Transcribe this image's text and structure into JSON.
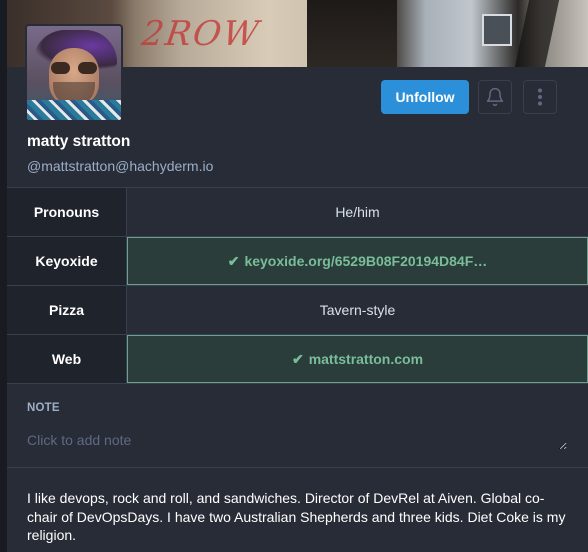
{
  "header": {
    "graffiti_text": "2ROW"
  },
  "account": {
    "display_name": "matty stratton",
    "handle": "@mattstratton@hachyderm.io"
  },
  "actions": {
    "unfollow_label": "Unfollow",
    "bell_icon": "bell-icon",
    "more_icon": "more-vertical-icon"
  },
  "fields": [
    {
      "name": "Pronouns",
      "value": "He/him",
      "verified": false
    },
    {
      "name": "Keyoxide",
      "value": "keyoxide.org/6529B08F20194D84F…",
      "verified": true
    },
    {
      "name": "Pizza",
      "value": "Tavern-style",
      "verified": false
    },
    {
      "name": "Web",
      "value": "mattstratton.com",
      "verified": true
    }
  ],
  "note": {
    "label": "NOTE",
    "placeholder": "Click to add note"
  },
  "bio": "I like devops, rock and roll, and sandwiches. Director of DevRel at Aiven. Global co-chair of DevOpsDays. I have two Australian Shepherds and three kids. Diet Coke is my religion.",
  "colors": {
    "accent": "#2b90d9",
    "verified": "#79bd9a",
    "verified_bg": "#2a3d3a",
    "card_bg": "#282c37",
    "page_bg": "#191b22",
    "muted_text": "#9baec8"
  }
}
